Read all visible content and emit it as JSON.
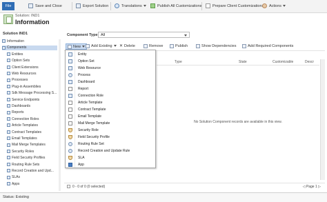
{
  "ribbon": {
    "file_label": "File",
    "items": [
      {
        "label": "Save and Close"
      },
      {
        "label": "Export Solution"
      },
      {
        "label": "Translations"
      },
      {
        "label": "Publish All Customizations"
      },
      {
        "label": "Prepare Client Customizations"
      },
      {
        "label": "Actions"
      }
    ]
  },
  "header": {
    "breadcrumb": "Solution: IND1",
    "title": "Information"
  },
  "sidebar": {
    "title": "Solution IND1",
    "items": [
      {
        "label": "Information",
        "selected": false
      },
      {
        "label": "Components",
        "selected": true
      },
      {
        "label": "Entities",
        "selected": false
      },
      {
        "label": "Option Sets",
        "selected": false
      },
      {
        "label": "Client Extensions",
        "selected": false
      },
      {
        "label": "Web Resources",
        "selected": false
      },
      {
        "label": "Processes",
        "selected": false
      },
      {
        "label": "Plug-in Assemblies",
        "selected": false
      },
      {
        "label": "Sdk Message Processing S...",
        "selected": false
      },
      {
        "label": "Service Endpoints",
        "selected": false
      },
      {
        "label": "Dashboards",
        "selected": false
      },
      {
        "label": "Reports",
        "selected": false
      },
      {
        "label": "Connection Roles",
        "selected": false
      },
      {
        "label": "Article Templates",
        "selected": false
      },
      {
        "label": "Contract Templates",
        "selected": false
      },
      {
        "label": "Email Templates",
        "selected": false
      },
      {
        "label": "Mail Merge Templates",
        "selected": false
      },
      {
        "label": "Security Roles",
        "selected": false
      },
      {
        "label": "Field Security Profiles",
        "selected": false
      },
      {
        "label": "Routing Rule Sets",
        "selected": false
      },
      {
        "label": "Record Creation and Upd...",
        "selected": false
      },
      {
        "label": "SLAs",
        "selected": false
      },
      {
        "label": "Apps",
        "selected": false
      }
    ]
  },
  "component_type": {
    "label": "Component Type",
    "value": "All"
  },
  "toolbar": {
    "new_label": "New",
    "add_existing_label": "Add Existing",
    "delete_label": "Delete",
    "remove_label": "Remove",
    "publish_label": "Publish",
    "show_dependencies_label": "Show Dependencies",
    "add_required_label": "Add Required Components"
  },
  "new_menu": {
    "items": [
      {
        "label": "Entity",
        "icon": "entity-icon"
      },
      {
        "label": "Option Set",
        "icon": "option-set-icon"
      },
      {
        "label": "Web Resource",
        "icon": "web-resource-icon"
      },
      {
        "label": "Process",
        "icon": "process-icon"
      },
      {
        "label": "Dashboard",
        "icon": "dashboard-icon"
      },
      {
        "label": "Report",
        "icon": "report-icon"
      },
      {
        "label": "Connection Role",
        "icon": "connection-role-icon"
      },
      {
        "label": "Article Template",
        "icon": "article-template-icon"
      },
      {
        "label": "Contract Template",
        "icon": "contract-template-icon"
      },
      {
        "label": "Email Template",
        "icon": "email-template-icon"
      },
      {
        "label": "Mail Merge Template",
        "icon": "mail-merge-template-icon"
      },
      {
        "label": "Security Role",
        "icon": "security-role-icon"
      },
      {
        "label": "Field Security Profile",
        "icon": "field-security-profile-icon"
      },
      {
        "label": "Routing Rule Set",
        "icon": "routing-rule-set-icon"
      },
      {
        "label": "Record Creation and Update Rule",
        "icon": "record-creation-rule-icon"
      },
      {
        "label": "SLA",
        "icon": "sla-icon"
      },
      {
        "label": "App",
        "icon": "app-icon"
      }
    ]
  },
  "grid": {
    "columns": [
      "Type",
      "State",
      "Customizable",
      "Descr"
    ],
    "empty_message": "No Solution Component records are available in this view."
  },
  "footer": {
    "selection": "0 - 0 of 0 (0 selected)",
    "pager": "◁ Page 1 ▷"
  },
  "status": {
    "text": "Status: Existing"
  }
}
